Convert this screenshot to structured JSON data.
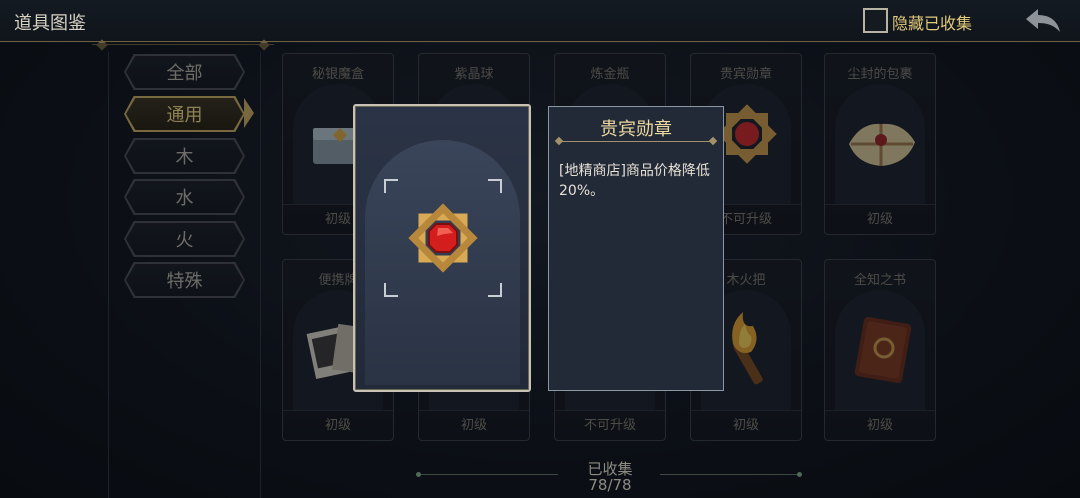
{
  "header": {
    "title": "道具图鉴",
    "hide_collected_label": "隐藏已收集",
    "back_icon": "back-arrow-icon"
  },
  "sidebar": {
    "tabs": [
      {
        "label": "全部",
        "active": false
      },
      {
        "label": "通用",
        "active": true
      },
      {
        "label": "木",
        "active": false
      },
      {
        "label": "水",
        "active": false
      },
      {
        "label": "火",
        "active": false
      },
      {
        "label": "特殊",
        "active": false
      }
    ]
  },
  "grid": {
    "items": [
      {
        "name": "秘银魔盒",
        "level": "初级"
      },
      {
        "name": "紫晶球",
        "level": ""
      },
      {
        "name": "炼金瓶",
        "level": ""
      },
      {
        "name": "贵宾勋章",
        "level": "不可升级"
      },
      {
        "name": "尘封的包裹",
        "level": "初级"
      },
      {
        "name": "便携牌",
        "level": "初级"
      },
      {
        "name": "",
        "level": "初级"
      },
      {
        "name": "",
        "level": "不可升级"
      },
      {
        "name": "木火把",
        "level": "初级"
      },
      {
        "name": "全知之书",
        "level": "初级"
      }
    ]
  },
  "popup": {
    "item_name": "贵宾勋章",
    "description": "[地精商店]商品价格降低20%。",
    "icon": "star-medal-ruby-icon"
  },
  "footer": {
    "label": "已收集",
    "count": "78/78"
  },
  "colors": {
    "gold": "#c9ad62",
    "accent_text": "#efd9a0",
    "background": "#10151d"
  }
}
